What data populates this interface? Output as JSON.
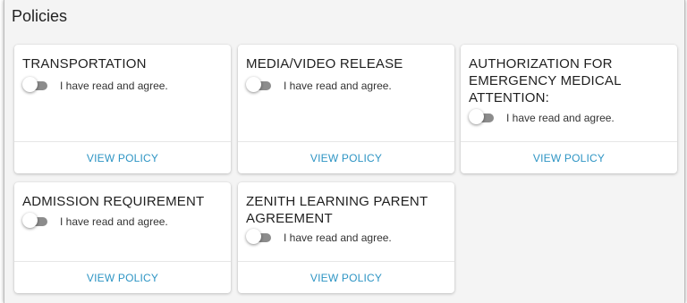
{
  "page": {
    "title": "Policies"
  },
  "toggle_label": "I have read and agree.",
  "link_label": "VIEW POLICY",
  "policies": [
    {
      "title": "TRANSPORTATION",
      "agreed": false
    },
    {
      "title": "MEDIA/VIDEO RELEASE",
      "agreed": false
    },
    {
      "title": "AUTHORIZATION FOR EMERGENCY MEDICAL ATTENTION:",
      "agreed": false
    },
    {
      "title": "ADMISSION REQUIREMENT",
      "agreed": false
    },
    {
      "title": "ZENITH LEARNING PARENT AGREEMENT",
      "agreed": false
    }
  ],
  "colors": {
    "link": "#2e95c4",
    "toggle_off_track": "#8c8c8c",
    "panel_bg": "#f4f4f4"
  }
}
